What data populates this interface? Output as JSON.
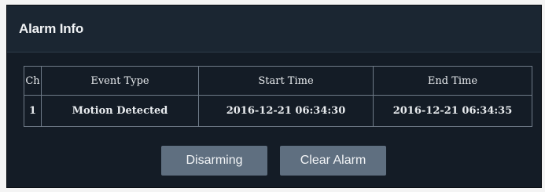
{
  "panel": {
    "title": "Alarm Info"
  },
  "table": {
    "headers": [
      "Ch",
      "Event Type",
      "Start Time",
      "End Time"
    ],
    "rows": [
      [
        "1",
        "Motion Detected",
        "2016-12-21 06:34:30",
        "2016-12-21 06:34:35"
      ]
    ]
  },
  "buttons": {
    "disarm_label": "Disarming",
    "clear_label": "Clear Alarm"
  }
}
